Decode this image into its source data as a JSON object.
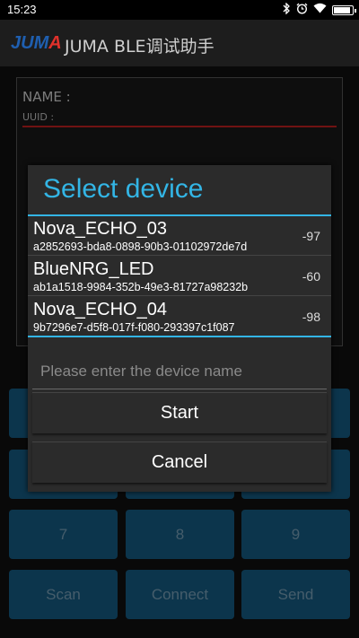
{
  "status_bar": {
    "time": "15:23",
    "icons": [
      "bluetooth-icon",
      "alarm-icon",
      "wifi-icon",
      "battery-icon"
    ]
  },
  "app": {
    "logo_part1": "JUM",
    "logo_part2": "A",
    "title": "JUMA BLE调试助手"
  },
  "card": {
    "name_label": "NAME :",
    "uuid_label": "UUID :"
  },
  "buttons": {
    "row1": [
      "",
      "",
      ""
    ],
    "row2": [
      "",
      "",
      ""
    ],
    "row3": [
      "7",
      "8",
      "9"
    ],
    "row4": [
      "Scan",
      "Connect",
      "Send"
    ]
  },
  "dialog": {
    "title": "Select device",
    "devices": [
      {
        "name": "Nova_ECHO_03",
        "uuid": "a2852693-bda8-0898-90b3-01102972de7d",
        "rssi": "-97"
      },
      {
        "name": "BlueNRG_LED",
        "uuid": "ab1a1518-9984-352b-49e3-81727a98232b",
        "rssi": "-60"
      },
      {
        "name": "Nova_ECHO_04",
        "uuid": "9b7296e7-d5f8-017f-f080-293397c1f087",
        "rssi": "-98"
      }
    ],
    "input_placeholder": "Please enter the device name",
    "start_label": "Start",
    "cancel_label": "Cancel"
  },
  "colors": {
    "accent": "#33b5e5",
    "button": "#17618a",
    "logo_blue": "#1f5fb0",
    "logo_red": "#e0312b"
  }
}
